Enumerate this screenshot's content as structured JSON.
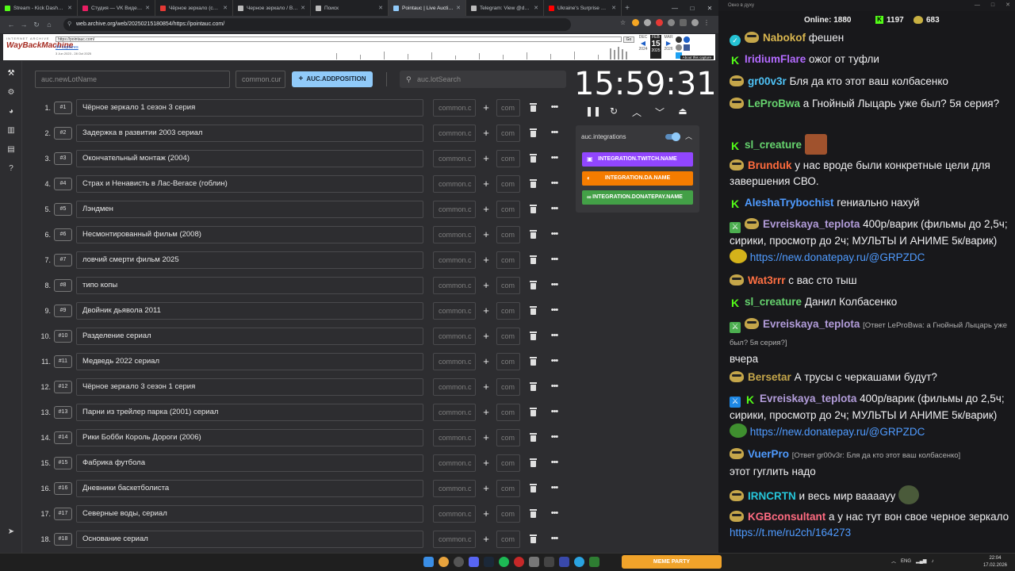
{
  "browser": {
    "tabs": [
      {
        "title": "Stream - Kick Dashboard",
        "color": "#53fc18"
      },
      {
        "title": "Студия — VK Видео Live",
        "color": "#e91e63"
      },
      {
        "title": "Чёрное зеркало (сериал)",
        "color": "#e53935"
      },
      {
        "title": "Черное зеркало / Black Mirror",
        "color": "#bbbbbb"
      },
      {
        "title": "Поиск",
        "color": "#bbbbbb"
      },
      {
        "title": "Pointauc | Live Auction",
        "color": "#90caf9",
        "active": true
      },
      {
        "title": "Telegram: View @dvach",
        "color": "#bbbbbb"
      },
      {
        "title": "Ukraine's Surprise Counter",
        "color": "#ff0000"
      }
    ],
    "url": "web.archive.org/web/20250215180854/https://pointauc.com/"
  },
  "wayback": {
    "archive_label": "INTERNET ARCHIVE",
    "logo": "WayBackMachine",
    "url": "https://pointauc.com/",
    "go": "Go",
    "captures": "54 captures",
    "range": "3 Jun 2023 - 28 Oct 2025",
    "cal": [
      {
        "mon": "DEC",
        "year": "2024"
      },
      {
        "mon": "FEB",
        "day": "15",
        "year": "2025"
      },
      {
        "mon": "MAR",
        "year": "2026"
      }
    ],
    "about": "About this capture"
  },
  "auction": {
    "new_lot_placeholder": "auc.newLotName",
    "amount_placeholder": "common.cur",
    "add_position": "AUC.ADDPOSITION",
    "search_placeholder": "auc.lotSearch",
    "row_amount_placeholder": "common.c",
    "row_add_placeholder": "com",
    "lots": [
      {
        "idx": "1.",
        "badge": "#1",
        "name": "Чёрное зеркало 1 сезон 3 серия"
      },
      {
        "idx": "2.",
        "badge": "#2",
        "name": "Задержка в развитии 2003 сериал"
      },
      {
        "idx": "3.",
        "badge": "#3",
        "name": "Окончательный монтаж (2004)"
      },
      {
        "idx": "4.",
        "badge": "#4",
        "name": "Страх и Ненависть в Лас-Вегасе (гоблин)"
      },
      {
        "idx": "5.",
        "badge": "#5",
        "name": "Лэндмен"
      },
      {
        "idx": "6.",
        "badge": "#6",
        "name": "Несмонтированный фильм (2008)"
      },
      {
        "idx": "7.",
        "badge": "#7",
        "name": "ловчий смерти фильм 2025"
      },
      {
        "idx": "8.",
        "badge": "#8",
        "name": "типо копы"
      },
      {
        "idx": "9.",
        "badge": "#9",
        "name": "Двойник дьявола 2011"
      },
      {
        "idx": "10.",
        "badge": "#10",
        "name": "Разделение сериал"
      },
      {
        "idx": "11.",
        "badge": "#11",
        "name": "Медведь 2022 сериал"
      },
      {
        "idx": "12.",
        "badge": "#12",
        "name": "Чёрное зеркало 3 сезон 1 серия"
      },
      {
        "idx": "13.",
        "badge": "#13",
        "name": "Парни из трейлер парка (2001) сериал"
      },
      {
        "idx": "14.",
        "badge": "#14",
        "name": "Рики Бобби Король Дороги (2006)"
      },
      {
        "idx": "15.",
        "badge": "#15",
        "name": "Фабрика футбола"
      },
      {
        "idx": "16.",
        "badge": "#16",
        "name": "Дневники баскетболиста"
      },
      {
        "idx": "17.",
        "badge": "#17",
        "name": "Северные воды, сериал"
      },
      {
        "idx": "18.",
        "badge": "#18",
        "name": "Основание сериал"
      }
    ],
    "timer": "15:59:31",
    "integrations": {
      "title": "auc.integrations",
      "enabled": true,
      "buttons": [
        {
          "label": "INTEGRATION.TWITCH.NAME",
          "color": "#9146ff",
          "icon": "twitch-icon"
        },
        {
          "label": "INTEGRATION.DA.NAME",
          "color": "#f57c00",
          "icon": "donationalerts-icon"
        },
        {
          "label": "INTEGRATION.DONATEPAY.NAME",
          "color": "#43a047",
          "icon": "donatepay-icon"
        }
      ]
    }
  },
  "chat": {
    "window_title": "Окно в духу",
    "online_label": "Online:",
    "online": "1880",
    "kick_count": "1197",
    "other_count": "683",
    "messages": [
      {
        "user": "Nabokof",
        "color": "#d9b64f",
        "text": "фешен",
        "badges": [
          "verified",
          "av"
        ]
      },
      {
        "user": "IridiumFlare",
        "color": "#b36bff",
        "text": "ожог от туфли",
        "badges": [
          "kick"
        ]
      },
      {
        "user": "gr00v3r",
        "color": "#4fc3f7",
        "text": "Бля да кто этот ваш колбасенко",
        "badges": [
          "av"
        ]
      },
      {
        "user": "LeProBwa",
        "color": "#66d36e",
        "text": "а Гнойный Лыцарь уже был? 5я серия?",
        "badges": [
          "av"
        ]
      },
      {
        "user": "sl_creature",
        "color": "#66d36e",
        "text": "",
        "badges": [
          "kick"
        ]
      },
      {
        "user": "Brunduk",
        "color": "#ff6b3d",
        "text": "у нас вроде были конкретные цели для завершения СВО.",
        "badges": [
          "av"
        ]
      },
      {
        "user": "AleshaTrybochist",
        "color": "#4f9bff",
        "text": "гениально нахуй",
        "badges": [
          "kick"
        ]
      },
      {
        "user": "Evreiskaya_teplota",
        "color": "#b39ddb",
        "text": "400р/варик (фильмы до 2,5ч; сирики, просмотр до 2ч; МУЛЬТЫ И АНИМЕ 5к/варик)",
        "link": "https://new.donatepay.ru/@GRPZDC",
        "badges": [
          "sword",
          "av"
        ]
      },
      {
        "user": "Wat3rrr",
        "color": "#ff7043",
        "text": "с вас сто тыш",
        "badges": [
          "av"
        ]
      },
      {
        "user": "sl_creature",
        "color": "#66d36e",
        "text": "Данил Колбасенко",
        "badges": [
          "kick"
        ]
      },
      {
        "user": "Evreiskaya_teplota",
        "color": "#b39ddb",
        "reply": "[Ответ LeProBwa: а Гнойный Лыцарь уже был? 5я серия?]",
        "text": "вчера",
        "badges": [
          "sword",
          "av"
        ]
      },
      {
        "user": "Bersetar",
        "color": "#c5a64a",
        "text": "А трусы с черкашами будут?",
        "badges": [
          "av"
        ]
      },
      {
        "user": "Evreiskaya_teplota",
        "color": "#b39ddb",
        "text": "400р/варик (фильмы до 2,5ч; сирики, просмотр до 2ч; МУЛЬТЫ И АНИМЕ 5к/варик)",
        "link": "https://new.donatepay.ru/@GRPZDC",
        "badges": [
          "blue",
          "kick"
        ]
      },
      {
        "user": "VuerPro",
        "color": "#4f9bff",
        "reply": "[Ответ gr00v3r: Бля да кто этот ваш колбасенко]",
        "text": "этот гуглить надо",
        "badges": [
          "av"
        ]
      },
      {
        "user": "IRNCRTN",
        "color": "#26c6da",
        "text": "и весь мир ваааауу",
        "badges": [
          "av"
        ]
      },
      {
        "user": "KGBconsultant",
        "color": "#ff6b81",
        "text": "а у нас тут вон свое черное зеркало",
        "link": "https://t.me/ru2ch/164273",
        "badges": [
          "av"
        ]
      }
    ]
  },
  "taskbar": {
    "widget": "MEME PARTY",
    "lang": "ENG",
    "time": "22:04",
    "date": "17.02.2026"
  }
}
